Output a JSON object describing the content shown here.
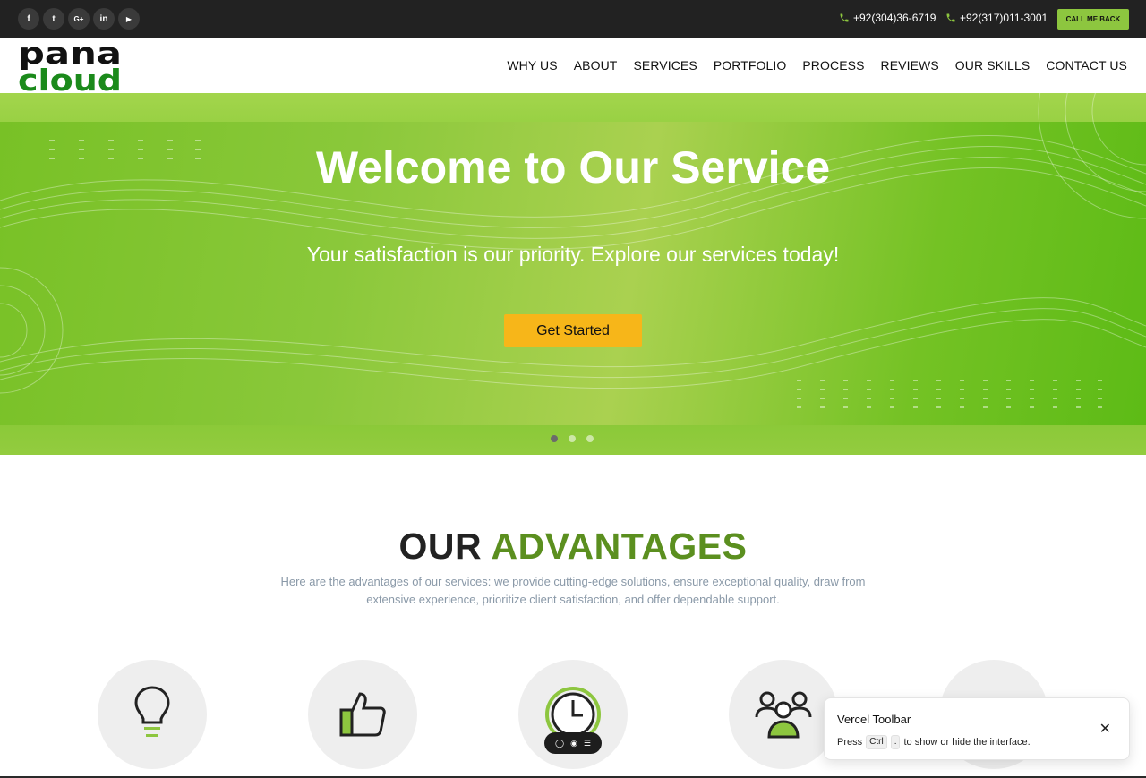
{
  "topbar": {
    "social": [
      {
        "icon": "facebook-icon",
        "glyph": "f"
      },
      {
        "icon": "twitter-icon",
        "glyph": "t"
      },
      {
        "icon": "google-plus-icon",
        "glyph": "G+"
      },
      {
        "icon": "linkedin-icon",
        "glyph": "in"
      },
      {
        "icon": "youtube-icon",
        "glyph": "▶"
      }
    ],
    "phone1": "+92(304)36-6719",
    "phone2": "+92(317)011-3001",
    "callback_label": "CALL ME BACK",
    "accent": "#8dc63f"
  },
  "header": {
    "logo_line1": "pana",
    "logo_line2": "cloud",
    "nav": [
      "WHY US",
      "ABOUT",
      "SERVICES",
      "PORTFOLIO",
      "PROCESS",
      "REVIEWS",
      "OUR SKILLS",
      "CONTACT US"
    ]
  },
  "hero": {
    "title": "Welcome to Our Service",
    "subtitle": "Your satisfaction is our priority. Explore our services today!",
    "cta": "Get Started",
    "cta_color": "#f7b619",
    "slides": 3,
    "active_slide": 1
  },
  "advantages": {
    "title_part1": "OUR",
    "title_part2": "ADVANTAGES",
    "description": "Here are the advantages of our services: we provide cutting-edge solutions, ensure exceptional quality, draw from extensive experience, prioritize client satisfaction, and offer dependable support.",
    "icons": [
      "lightbulb-icon",
      "thumbs-up-icon",
      "clock-icon",
      "users-icon",
      "monitor-icon"
    ]
  },
  "vercel_toast": {
    "title": "Vercel Toolbar",
    "text_before": "Press",
    "key1": "Ctrl",
    "key2": ".",
    "text_after": "to show or hide the interface."
  }
}
